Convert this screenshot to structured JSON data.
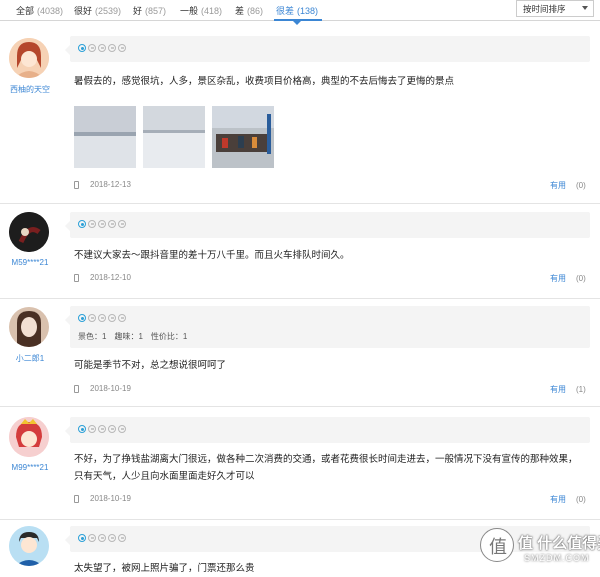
{
  "tabs": [
    {
      "label": "全部",
      "count": "(4038)"
    },
    {
      "label": "很好",
      "count": "(2539)"
    },
    {
      "label": "好",
      "count": "(857)"
    },
    {
      "label": "一般",
      "count": "(418)"
    },
    {
      "label": "差",
      "count": "(86)"
    },
    {
      "label": "很差",
      "count": "(138)"
    }
  ],
  "active_tab": "很差",
  "sort": {
    "label": "按时间排序"
  },
  "accent_color": "#3b86d4",
  "reviews": [
    {
      "user": "西柚的天空",
      "avatar_icon": "female-cartoon-avatar",
      "rating": 1,
      "text": "暑假去的，感觉很坑，人多，景区杂乱，收费项目价格高，典型的不去后悔去了更悔的景点",
      "photos": [
        "salt-lake-photo",
        "salt-lake-photo",
        "tourists-photo"
      ],
      "date": "2018-12-13",
      "useful": "有用",
      "useful_count": "(0)"
    },
    {
      "user": "M59****21",
      "avatar_icon": "user-photo-avatar",
      "rating": 1,
      "text": "不建议大家去～跟抖音里的差十万八千里。而且火车排队时间久。",
      "date": "2018-12-10",
      "useful": "有用",
      "useful_count": "(0)"
    },
    {
      "user": "小二郎1",
      "avatar_icon": "user-photo-avatar",
      "rating": 1,
      "scores": "景色：1　趣味：1　性价比：1",
      "text": "可能是季节不对，总之想说很呵呵了",
      "date": "2018-10-19",
      "useful": "有用",
      "useful_count": "(1)"
    },
    {
      "user": "M99****21",
      "avatar_icon": "female-cartoon-avatar",
      "rating": 1,
      "text": "不好，为了挣钱盐湖离大门很远，做各种二次消费的交通，或者花费很长时间走进去，一般情况下没有宣传的那种效果，只有天气，人少且向水面里面走好久才可以",
      "date": "2018-10-19",
      "useful": "有用",
      "useful_count": "(0)"
    },
    {
      "user": "",
      "avatar_icon": "male-cartoon-avatar",
      "rating": 1,
      "text": "太失望了，被网上照片骗了，门票还那么贵"
    }
  ],
  "watermark": {
    "cn": "值 什么值得买",
    "en": "SMZDM.COM"
  }
}
